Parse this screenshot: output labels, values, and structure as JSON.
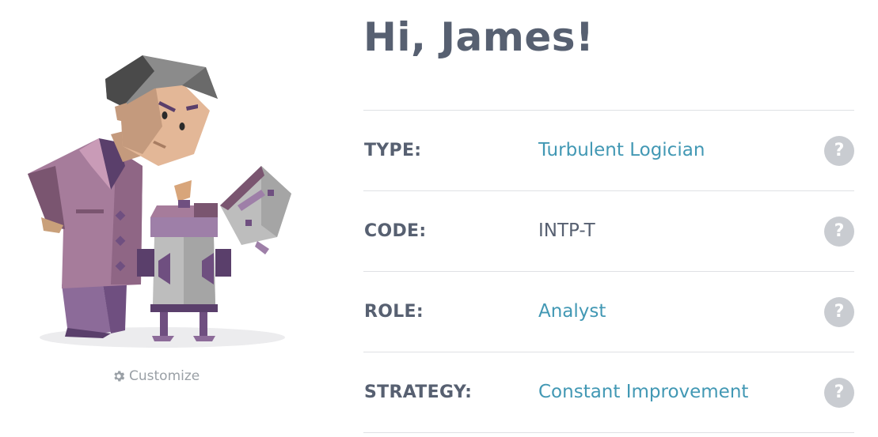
{
  "greeting": "Hi, James!",
  "customize_label": "Customize",
  "help_symbol": "?",
  "rows": [
    {
      "label": "TYPE:",
      "value": "Turbulent Logician"
    },
    {
      "label": "CODE:",
      "value": "INTP-T"
    },
    {
      "label": "ROLE:",
      "value": "Analyst"
    },
    {
      "label": "STRATEGY:",
      "value": "Constant Improvement"
    }
  ],
  "colors": {
    "heading": "#576071",
    "link": "#4298b4",
    "help_bg": "#c9ccd1",
    "divider": "#dfe1e4",
    "muted": "#9aa0a6"
  }
}
